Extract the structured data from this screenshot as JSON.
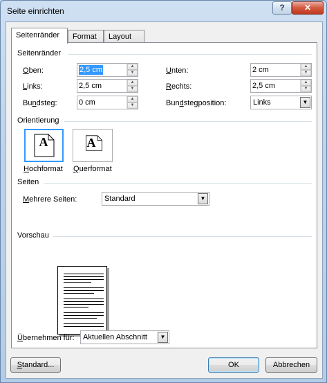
{
  "window": {
    "title": "Seite einrichten",
    "help_label": "?",
    "close_label": "✕"
  },
  "tabs": [
    {
      "label": "Seitenränder",
      "active": true
    },
    {
      "label": "Format",
      "active": false
    },
    {
      "label": "Layout",
      "active": false
    }
  ],
  "margins": {
    "section_label": "Seitenränder",
    "oben": {
      "label": "Oben:",
      "value": "2,5 cm"
    },
    "unten": {
      "label": "Unten:",
      "value": "2 cm"
    },
    "links": {
      "label": "Links:",
      "value": "2,5 cm"
    },
    "rechts": {
      "label": "Rechts:",
      "value": "2,5 cm"
    },
    "bundsteg": {
      "label": "Bundsteg:",
      "value": "0 cm"
    },
    "bundstegposition": {
      "label": "Bundstegposition:",
      "value": "Links"
    }
  },
  "orientation": {
    "section_label": "Orientierung",
    "portrait_label": "Hochformat",
    "landscape_label": "Querformat",
    "icon_letter": "A",
    "selected": "Hochformat"
  },
  "pages": {
    "section_label": "Seiten",
    "multiple_label": "Mehrere Seiten:",
    "multiple_value": "Standard"
  },
  "preview": {
    "section_label": "Vorschau"
  },
  "apply": {
    "label": "Übernehmen für:",
    "value": "Aktuellen Abschnitt"
  },
  "buttons": {
    "default_label": "Standard...",
    "ok_label": "OK",
    "cancel_label": "Abbrechen"
  },
  "colors": {
    "selection": "#3399ff",
    "accent_border": "#3399ff",
    "close_button": "#c0391e"
  }
}
